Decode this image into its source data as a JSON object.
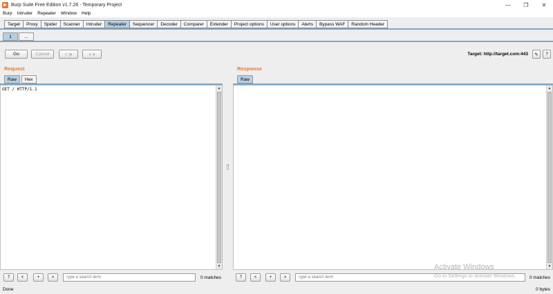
{
  "window": {
    "title": "Burp Suite Free Edition v1.7.26 - Temporary Project",
    "controls": {
      "minimize": "—",
      "maximize": "❐",
      "close": "✕"
    }
  },
  "menu": [
    "Burp",
    "Intruder",
    "Repeater",
    "Window",
    "Help"
  ],
  "main_tabs": [
    "Target",
    "Proxy",
    "Spider",
    "Scanner",
    "Intruder",
    "Repeater",
    "Sequencer",
    "Decoder",
    "Comparer",
    "Extender",
    "Project options",
    "User options",
    "Alerts",
    "Bypass WAF",
    "Random Header"
  ],
  "active_main_tab": "Repeater",
  "sub_tabs": [
    "1",
    "..."
  ],
  "toolbar": {
    "go": "Go",
    "cancel": "Cancel",
    "back": "< |▾",
    "forward": "> ▾",
    "target": "Target: http://target.com:443",
    "edit_icon": "✎",
    "help": "?"
  },
  "request": {
    "title": "Request",
    "tabs": [
      "Raw",
      "Hex"
    ],
    "content": "GET / HTTP/1.1"
  },
  "response": {
    "title": "Response",
    "tabs": [
      "Raw"
    ],
    "content": ""
  },
  "search": {
    "help": "?",
    "prev": "<",
    "add": "+",
    "next": ">",
    "placeholder": "Type a search term",
    "request_matches": "0 matches",
    "response_matches": "0 matches"
  },
  "status": {
    "left": "Done",
    "right": "0 bytes"
  },
  "watermark": {
    "title": "Activate Windows",
    "subtitle": "Go to Settings to activate Windows."
  },
  "colors": {
    "accent": "#e8792b",
    "tab_active": "#b6cfe2",
    "tab_line": "#7ea6c6"
  }
}
